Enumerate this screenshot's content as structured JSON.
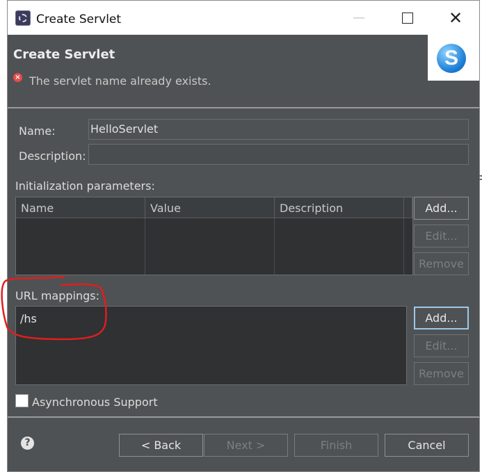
{
  "window": {
    "title": "Create Servlet",
    "controls": {
      "minimize": "—",
      "maximize": "",
      "close": "✕"
    }
  },
  "banner": {
    "title": "Create Servlet",
    "message": "The servlet name already exists.",
    "logo_letter": "S"
  },
  "form": {
    "name_label": "Name:",
    "name_value": "HelloServlet",
    "description_label": "Description:",
    "description_value": ""
  },
  "init_params": {
    "label": "Initialization parameters:",
    "columns": [
      "Name",
      "Value",
      "Description"
    ],
    "buttons": {
      "add": "Add...",
      "edit": "Edit...",
      "remove": "Remove"
    }
  },
  "url_mappings": {
    "label": "URL mappings:",
    "items": [
      "/hs"
    ],
    "buttons": {
      "add": "Add...",
      "edit": "Edit...",
      "remove": "Remove"
    }
  },
  "async": {
    "label": "Asynchronous Support",
    "checked": false
  },
  "footer": {
    "help": "?",
    "back": "< Back",
    "next": "Next >",
    "finish": "Finish",
    "cancel": "Cancel"
  },
  "colors": {
    "dialog_bg": "#4f5254",
    "list_bg": "#2f3133",
    "error": "#e64c4c",
    "annotation": "#e01e1e",
    "focus": "#9fc8e8"
  }
}
